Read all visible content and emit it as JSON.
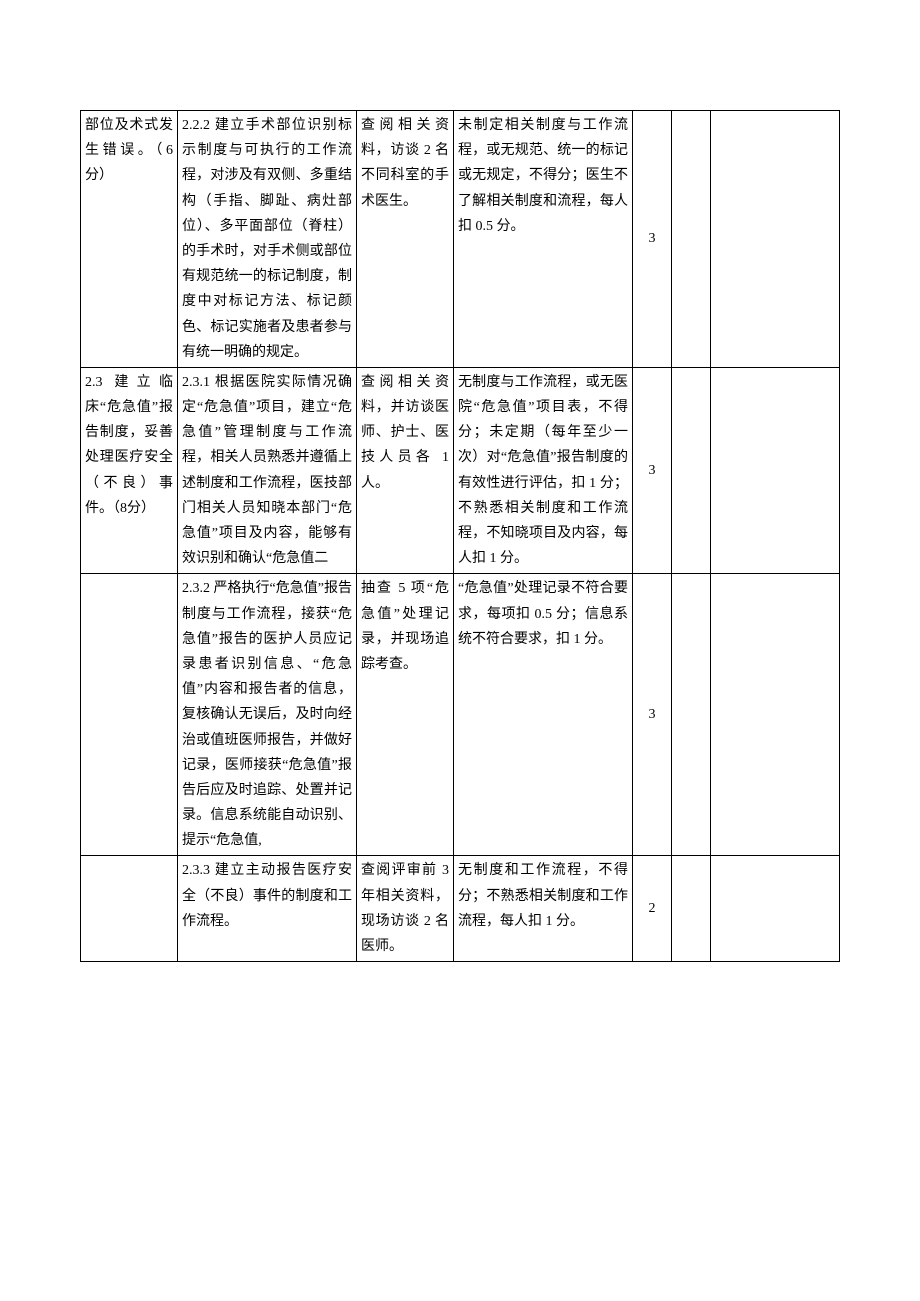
{
  "rows": [
    {
      "c1": "部位及术式发生错误。（6 分）",
      "c2": "2.2.2 建立手术部位识别标示制度与可执行的工作流程，对涉及有双侧、多重结构（手指、脚趾、病灶部位）、多平面部位（脊柱）的手术时，对手术侧或部位有规范统一的标记制度，制度中对标记方法、标记颜色、标记实施者及患者参与有统一明确的规定。",
      "c3": "查阅相关资料，访谈 2 名不同科室的手术医生。",
      "c4": "未制定相关制度与工作流程，或无规范、统一的标记或无规定，不得分；医生不了解相关制度和流程，每人扣 0.5 分。",
      "c5": "3",
      "c6": "",
      "c7": ""
    },
    {
      "c1": "2.3 建立临床“危急值”报告制度，妥善处理医疗安全（不良）事件。（8分）",
      "c2": "2.3.1 根据医院实际情况确定“危急值”项目，建立“危急值”管理制度与工作流程，相关人员熟悉并遵循上述制度和工作流程，医技部门相关人员知晓本部门“危急值”项目及内容，能够有效识别和确认“危急值二",
      "c3": "查阅相关资料，并访谈医师、护士、医技人员各 1 人。",
      "c4": "无制度与工作流程，或无医院“危急值”项目表，不得分；未定期（每年至少一次）对“危急值”报告制度的有效性进行评估，扣 1 分；不熟悉相关制度和工作流程，不知晓项目及内容，每人扣 1 分。",
      "c5": "3",
      "c6": "",
      "c7": ""
    },
    {
      "c1": "",
      "c2": "2.3.2 严格执行“危急值”报告制度与工作流程，接获“危急值”报告的医护人员应记录患者识别信息、“危急值”内容和报告者的信息，复核确认无误后，及时向经治或值班医师报告，并做好记录，医师接获“危急值”报告后应及时追踪、处置并记录。信息系统能自动识别、提示“危急值,",
      "c3": "抽查 5 项“危急值”处理记录，并现场追踪考查。",
      "c4": "“危急值”处理记录不符合要求，每项扣 0.5 分；信息系统不符合要求，扣 1 分。",
      "c5": "3",
      "c6": "",
      "c7": ""
    },
    {
      "c1": "",
      "c2": "2.3.3 建立主动报告医疗安全（不良）事件的制度和工作流程。",
      "c3": "查阅评审前 3 年相关资料，现场访谈 2 名医师。",
      "c4": "无制度和工作流程，不得分；不熟悉相关制度和工作流程，每人扣 1 分。",
      "c5": "2",
      "c6": "",
      "c7": ""
    }
  ]
}
